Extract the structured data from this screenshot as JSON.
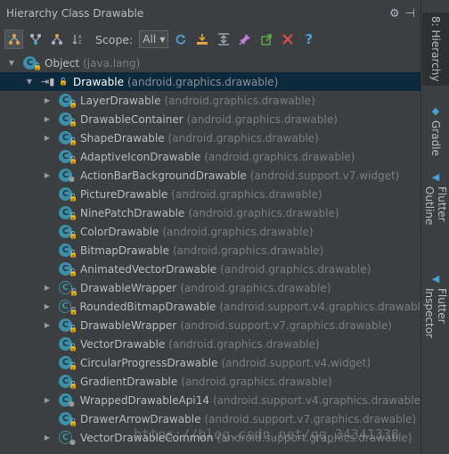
{
  "panel": {
    "title": "Hierarchy Class Drawable",
    "gear_icon": "⚙",
    "pin_icon": "⊣"
  },
  "toolbar": {
    "scope_label": "Scope:",
    "scope_value": "All",
    "buttons": [
      "class-hierarchy",
      "supertypes",
      "subtypes",
      "sort-alpha",
      "refresh",
      "export",
      "expand-all",
      "pin",
      "pin-tab",
      "close",
      "help"
    ]
  },
  "tree": {
    "root": {
      "name": "Object",
      "pkg": "(java.lang)"
    },
    "selected": {
      "name": "Drawable",
      "pkg": "(android.graphics.drawable)"
    },
    "children": [
      {
        "name": "LayerDrawable",
        "pkg": "(android.graphics.drawable)",
        "expandable": true,
        "vis": "public"
      },
      {
        "name": "DrawableContainer",
        "pkg": "(android.graphics.drawable)",
        "expandable": true,
        "vis": "public"
      },
      {
        "name": "ShapeDrawable",
        "pkg": "(android.graphics.drawable)",
        "expandable": true,
        "vis": "public"
      },
      {
        "name": "AdaptiveIconDrawable",
        "pkg": "(android.graphics.drawable)",
        "expandable": false,
        "vis": "public"
      },
      {
        "name": "ActionBarBackgroundDrawable",
        "pkg": "(android.support.v7.widget)",
        "expandable": true,
        "vis": "package"
      },
      {
        "name": "PictureDrawable",
        "pkg": "(android.graphics.drawable)",
        "expandable": false,
        "vis": "public"
      },
      {
        "name": "NinePatchDrawable",
        "pkg": "(android.graphics.drawable)",
        "expandable": false,
        "vis": "public"
      },
      {
        "name": "ColorDrawable",
        "pkg": "(android.graphics.drawable)",
        "expandable": false,
        "vis": "public"
      },
      {
        "name": "BitmapDrawable",
        "pkg": "(android.graphics.drawable)",
        "expandable": false,
        "vis": "public"
      },
      {
        "name": "AnimatedVectorDrawable",
        "pkg": "(android.graphics.drawable)",
        "expandable": false,
        "vis": "public"
      },
      {
        "name": "DrawableWrapper",
        "pkg": "(android.graphics.drawable)",
        "expandable": true,
        "vis": "public",
        "partial": true
      },
      {
        "name": "RoundedBitmapDrawable",
        "pkg": "(android.support.v4.graphics.drawabl",
        "expandable": true,
        "vis": "public",
        "partial": true
      },
      {
        "name": "DrawableWrapper",
        "pkg": "(android.support.v7.graphics.drawable)",
        "expandable": true,
        "vis": "public"
      },
      {
        "name": "VectorDrawable",
        "pkg": "(android.graphics.drawable)",
        "expandable": false,
        "vis": "public"
      },
      {
        "name": "CircularProgressDrawable",
        "pkg": "(android.support.v4.widget)",
        "expandable": false,
        "vis": "public"
      },
      {
        "name": "GradientDrawable",
        "pkg": "(android.graphics.drawable)",
        "expandable": false,
        "vis": "public"
      },
      {
        "name": "WrappedDrawableApi14",
        "pkg": "(android.support.v4.graphics.drawable",
        "expandable": true,
        "vis": "package"
      },
      {
        "name": "DrawerArrowDrawable",
        "pkg": "(android.support.v7.graphics.drawable)",
        "expandable": false,
        "vis": "public"
      },
      {
        "name": "VectorDrawableCommon",
        "pkg": "(android.support.graphics.drawable)",
        "expandable": true,
        "vis": "package",
        "partial": true
      }
    ]
  },
  "sidebar": {
    "tabs": [
      "8: Hierarchy",
      "Gradle",
      "Flutter Outline",
      "Flutter Inspector"
    ]
  },
  "watermark": "https://blog.csdn.net/qq_34341338"
}
